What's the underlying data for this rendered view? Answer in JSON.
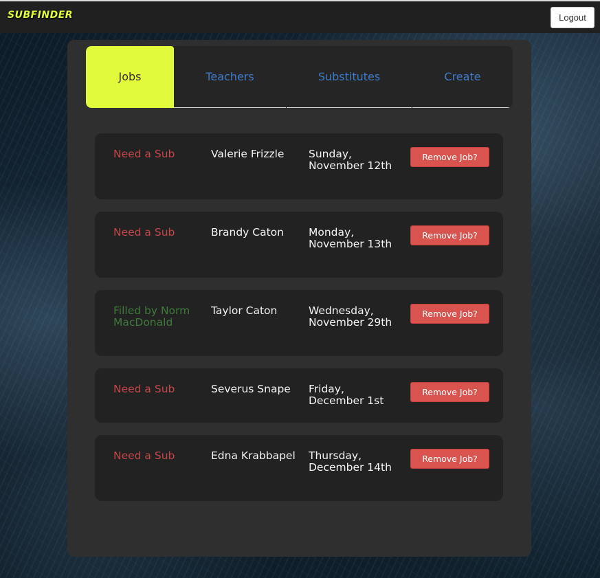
{
  "app": {
    "brand": "SUBFINDER",
    "logout_label": "Logout"
  },
  "tabs": [
    {
      "label": "Jobs",
      "active": true
    },
    {
      "label": "Teachers",
      "active": false
    },
    {
      "label": "Substitutes",
      "active": false
    },
    {
      "label": "Create",
      "active": false
    }
  ],
  "jobs": [
    {
      "status": "Need a Sub",
      "teacher": "Valerie Frizzle",
      "date": "Sunday, November 12th",
      "action": "Remove Job?"
    },
    {
      "status": "Need a Sub",
      "teacher": "Brandy Caton",
      "date": "Monday, November 13th",
      "action": "Remove Job?"
    },
    {
      "status": "Filled by Norm MacDonald",
      "teacher": "Taylor Caton",
      "date": "Wednesday, November 29th",
      "action": "Remove Job?"
    },
    {
      "status": "Need a Sub",
      "teacher": "Severus Snape",
      "date": "Friday, December 1st",
      "action": "Remove Job?"
    },
    {
      "status": "Need a Sub",
      "teacher": "Edna Krabbapel",
      "date": "Thursday, December 14th",
      "action": "Remove Job?"
    }
  ],
  "colors": {
    "accent": "#e2fa3c",
    "tab_link": "#3f7ac7",
    "need_status": "#c4464a",
    "filled_status": "#3f7a3b",
    "danger": "#d9534f"
  }
}
